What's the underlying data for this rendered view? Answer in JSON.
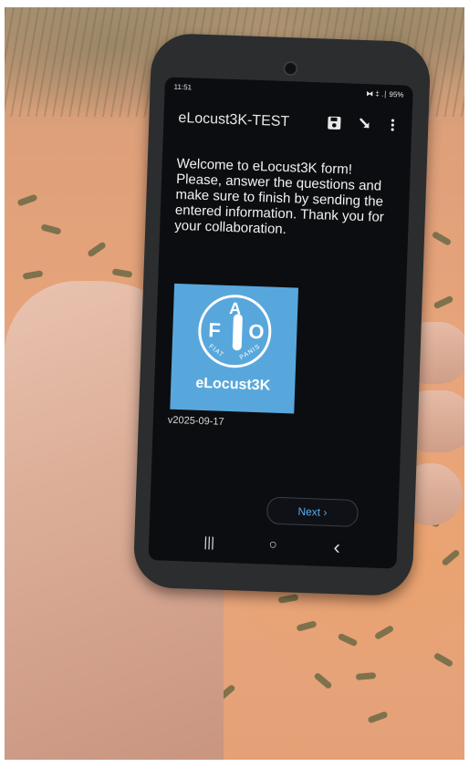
{
  "status_bar": {
    "time": "11:51",
    "indicators": "⧓ ‡ .∣ 95%",
    "battery_icon": "battery-icon"
  },
  "app": {
    "title": "eLocust3K-TEST",
    "toolbar": {
      "save_icon": "save-icon",
      "goto_icon": "arrow-icon",
      "menu_icon": "more-vert-icon"
    }
  },
  "form": {
    "welcome_text": "Welcome to eLocust3K form! Please, answer the questions and make sure to finish by sending the entered information. Thank you for your collaboration.",
    "logo": {
      "letter_f": "F",
      "letter_a": "A",
      "letter_o": "O",
      "motto_left": "FIAT",
      "motto_right": "PANIS",
      "name": "eLocust3K"
    },
    "version": "v2025-09-17",
    "next_label": "Next ›"
  },
  "navigation": {
    "recents": "|||",
    "home": "○",
    "back": "‹"
  },
  "colors": {
    "sand": "#e8a47a",
    "phone_body": "#2b2d2f",
    "screen": "#0c0d10",
    "fao_blue": "#58a7dc",
    "accent_link": "#5aa8e6"
  }
}
